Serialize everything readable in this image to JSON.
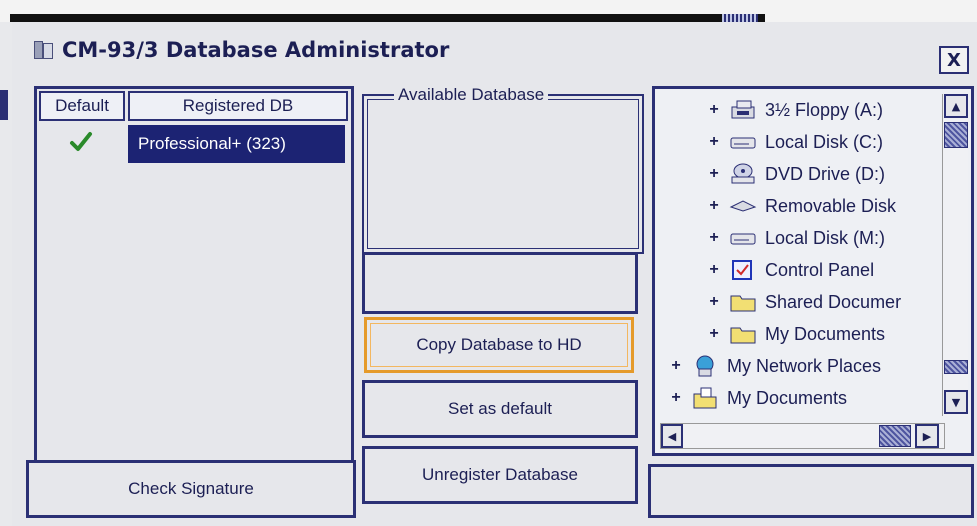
{
  "window": {
    "title": "CM-93/3 Database Administrator",
    "close_label": "X"
  },
  "registered": {
    "col_default": "Default",
    "col_registered": "Registered DB",
    "rows": [
      {
        "default": true,
        "name": "Professional+ (323)"
      }
    ]
  },
  "available": {
    "label": "Available Database"
  },
  "buttons": {
    "copy": "Copy Database to HD",
    "set_default": "Set as default",
    "unregister": "Unregister Database",
    "check_signature": "Check Signature"
  },
  "tree": {
    "items": [
      {
        "label": "3½ Floppy (A:)",
        "icon": "floppy-icon",
        "level": 1
      },
      {
        "label": "Local Disk (C:)",
        "icon": "hard-disk-icon",
        "level": 1
      },
      {
        "label": "DVD Drive (D:)",
        "icon": "dvd-drive-icon",
        "level": 1
      },
      {
        "label": "Removable Disk",
        "icon": "removable-disk-icon",
        "level": 1
      },
      {
        "label": "Local Disk (M:)",
        "icon": "hard-disk-icon",
        "level": 1
      },
      {
        "label": "Control Panel",
        "icon": "control-panel-icon",
        "level": 1
      },
      {
        "label": "Shared Documer",
        "icon": "folder-icon",
        "level": 1
      },
      {
        "label": "My Documents",
        "icon": "folder-icon",
        "level": 1
      },
      {
        "label": "My Network Places",
        "icon": "network-places-icon",
        "level": 0
      },
      {
        "label": "My Documents",
        "icon": "my-documents-icon",
        "level": 0
      }
    ]
  },
  "colors": {
    "border": "#2b3075",
    "selection": "#1c2373",
    "focus": "#e59a2a",
    "check": "#2a8a2a"
  }
}
